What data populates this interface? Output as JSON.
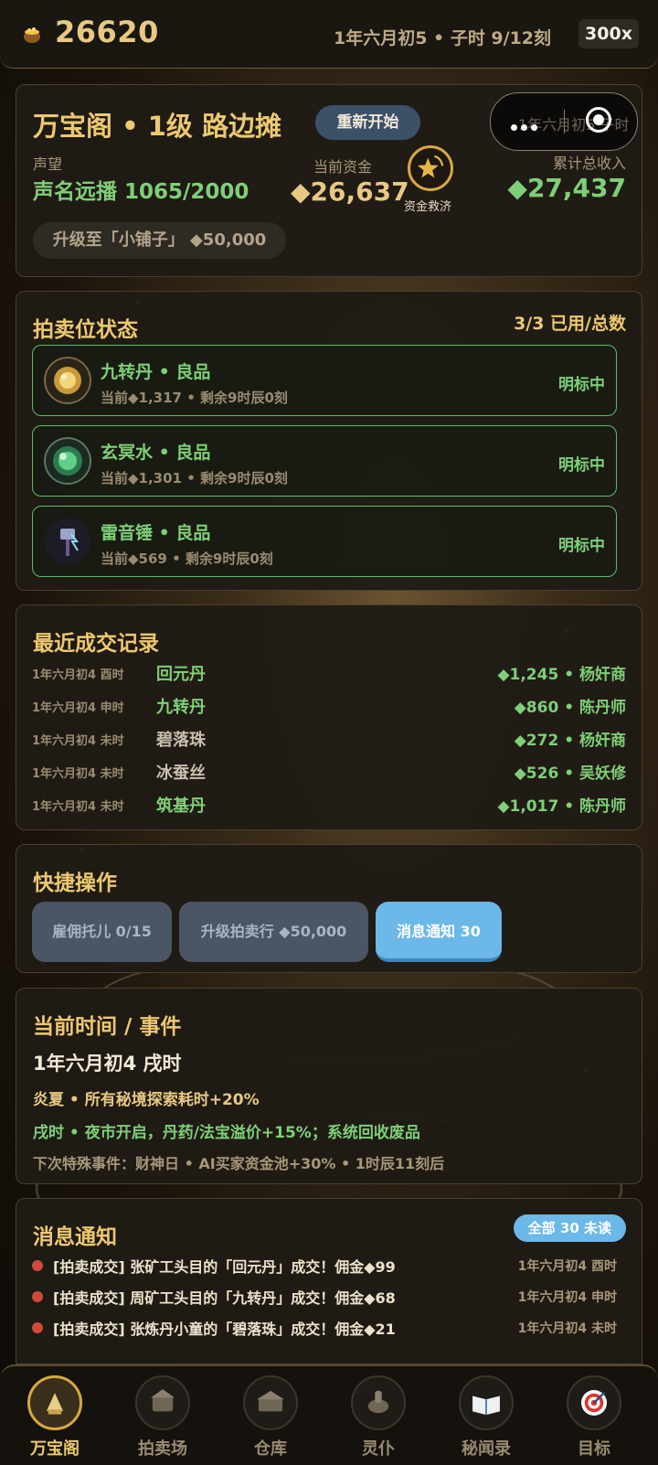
{
  "topbar": {
    "coins": "26620",
    "date": "1年六月初5 • 子时 9/12刻",
    "speed": "300x",
    "coin_icon": "treasure-pot-icon"
  },
  "shop": {
    "title": "万宝阁 • 1级 路边摊",
    "restart_label": "重新开始",
    "capsule_ghost_text": "1年六月初5 子时",
    "reputation_label": "声望",
    "reputation_value": "声名远播 1065/2000",
    "funds_label": "当前资金",
    "funds_value": "◆26,637",
    "rescue_label": "资金救济",
    "income_label": "累计总收入",
    "income_value": "◆27,437",
    "upgrade_label": "升级至「小铺子」 ◆50,000"
  },
  "auction": {
    "title": "拍卖位状态",
    "count": "3/3 已用/总数",
    "slots": [
      {
        "name": "九转丹 • 良品",
        "info": "当前◆1,317 • 剩余9时辰0刻",
        "state": "明标中",
        "icon": "golden-pill-icon"
      },
      {
        "name": "玄冥水 • 良品",
        "info": "当前◆1,301 • 剩余9时辰0刻",
        "state": "明标中",
        "icon": "green-water-orb-icon"
      },
      {
        "name": "雷音锤 • 良品",
        "info": "当前◆569 • 剩余9时辰0刻",
        "state": "明标中",
        "icon": "thunder-hammer-icon"
      }
    ]
  },
  "trades": {
    "title": "最近成交记录",
    "rows": [
      {
        "time": "1年六月初4 酉时",
        "item": "回元丹",
        "right": "◆1,245 • 杨奸商",
        "item_green": true
      },
      {
        "time": "1年六月初4 申时",
        "item": "九转丹",
        "right": "◆860 • 陈丹师",
        "item_green": true
      },
      {
        "time": "1年六月初4 未时",
        "item": "碧落珠",
        "right": "◆272 • 杨奸商",
        "item_green": false
      },
      {
        "time": "1年六月初4 未时",
        "item": "冰蚕丝",
        "right": "◆526 • 吴妖修",
        "item_green": false
      },
      {
        "time": "1年六月初4 未时",
        "item": "筑基丹",
        "right": "◆1,017 • 陈丹师",
        "item_green": true
      }
    ]
  },
  "quick": {
    "title": "快捷操作",
    "hire_label": "雇佣托儿 0/15",
    "upgrade_label": "升级拍卖行 ◆50,000",
    "notify_label": "消息通知 30"
  },
  "time_events": {
    "title": "当前时间 / 事件",
    "date": "1年六月初4 戌时",
    "season": "炎夏 • 所有秘境探索耗时+20%",
    "period": "戌时 • 夜市开启，丹药/法宝溢价+15%；系统回收废品",
    "next_event": "下次特殊事件：财神日 • AI买家资金池+30% • 1时辰11刻后"
  },
  "messages": {
    "title": "消息通知",
    "all_label": "全部 30 未读",
    "items": [
      {
        "text": "[拍卖成交] 张矿工头目的「回元丹」成交！佣金◆99",
        "time": "1年六月初4 酉时"
      },
      {
        "text": "[拍卖成交] 周矿工头目的「九转丹」成交！佣金◆68",
        "time": "1年六月初4 申时"
      },
      {
        "text": "[拍卖成交] 张炼丹小童的「碧落珠」成交！佣金◆21",
        "time": "1年六月初4 未时"
      }
    ]
  },
  "nav": {
    "items": [
      {
        "label": "万宝阁",
        "icon": "pavilion-icon",
        "active": true
      },
      {
        "label": "拍卖场",
        "icon": "auction-hall-icon",
        "active": false
      },
      {
        "label": "仓库",
        "icon": "warehouse-icon",
        "active": false
      },
      {
        "label": "灵仆",
        "icon": "spirit-servant-icon",
        "active": false
      },
      {
        "label": "秘闻录",
        "icon": "open-book-icon",
        "active": false
      },
      {
        "label": "目标",
        "icon": "target-icon",
        "active": false
      }
    ]
  },
  "colors": {
    "accent_gold": "#ecc870",
    "accent_green": "#7fcf78",
    "notify_blue": "#6cb8e8"
  }
}
